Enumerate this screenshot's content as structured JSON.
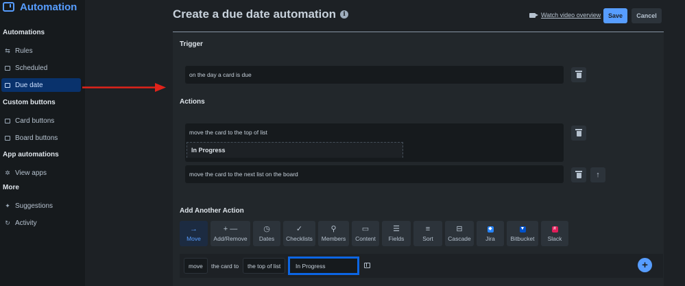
{
  "sidebar": {
    "app_title": "Automation",
    "sections": [
      {
        "heading": "Automations",
        "items": [
          {
            "label": "Rules",
            "icon": "sliders-icon"
          },
          {
            "label": "Scheduled",
            "icon": "calendar-icon"
          },
          {
            "label": "Due date",
            "icon": "calendar-icon",
            "active": true
          }
        ]
      },
      {
        "heading": "Custom buttons",
        "items": [
          {
            "label": "Card buttons",
            "icon": "card-icon"
          },
          {
            "label": "Board buttons",
            "icon": "board-icon"
          }
        ]
      },
      {
        "heading": "App automations",
        "items": [
          {
            "label": "View apps",
            "icon": "gear-icon"
          }
        ]
      },
      {
        "heading": "More",
        "items": [
          {
            "label": "Suggestions",
            "icon": "sparkle-icon"
          },
          {
            "label": "Activity",
            "icon": "refresh-icon"
          }
        ]
      }
    ]
  },
  "header": {
    "title": "Create a due date automation",
    "info_icon": "i",
    "video_link": "Watch video overview",
    "save_label": "Save",
    "cancel_label": "Cancel"
  },
  "trigger": {
    "heading": "Trigger",
    "text": "on the day a card is due"
  },
  "actions": {
    "heading": "Actions",
    "items": [
      {
        "text": "move the card to the top of list",
        "detail": "In Progress"
      },
      {
        "text": "move the card to the next list on the board"
      }
    ]
  },
  "add_action": {
    "heading": "Add Another Action",
    "tiles": [
      {
        "label": "Move",
        "icon": "arrow-right-icon",
        "active": true
      },
      {
        "label": "Add/Remove",
        "icon": "plus-minus-icon"
      },
      {
        "label": "Dates",
        "icon": "clock-icon"
      },
      {
        "label": "Checklists",
        "icon": "check-icon"
      },
      {
        "label": "Members",
        "icon": "person-icon"
      },
      {
        "label": "Content",
        "icon": "comment-icon"
      },
      {
        "label": "Fields",
        "icon": "fields-icon"
      },
      {
        "label": "Sort",
        "icon": "sort-icon"
      },
      {
        "label": "Cascade",
        "icon": "cascade-icon"
      },
      {
        "label": "Jira",
        "icon": "jira-icon",
        "color": "#2684ff"
      },
      {
        "label": "Bitbucket",
        "icon": "bitbucket-icon",
        "color": "#0052cc"
      },
      {
        "label": "Slack",
        "icon": "slack-icon",
        "color": "#e01e5a"
      }
    ]
  },
  "builder": {
    "move_chip": "move",
    "text_the_card_to": "the card to",
    "position_chip": "the top of list",
    "list_value": "In Progress",
    "add_label": "+"
  },
  "colors": {
    "accent": "#579dff",
    "selected_border": "#0c66e4",
    "annotation_arrow": "#e2231a"
  }
}
